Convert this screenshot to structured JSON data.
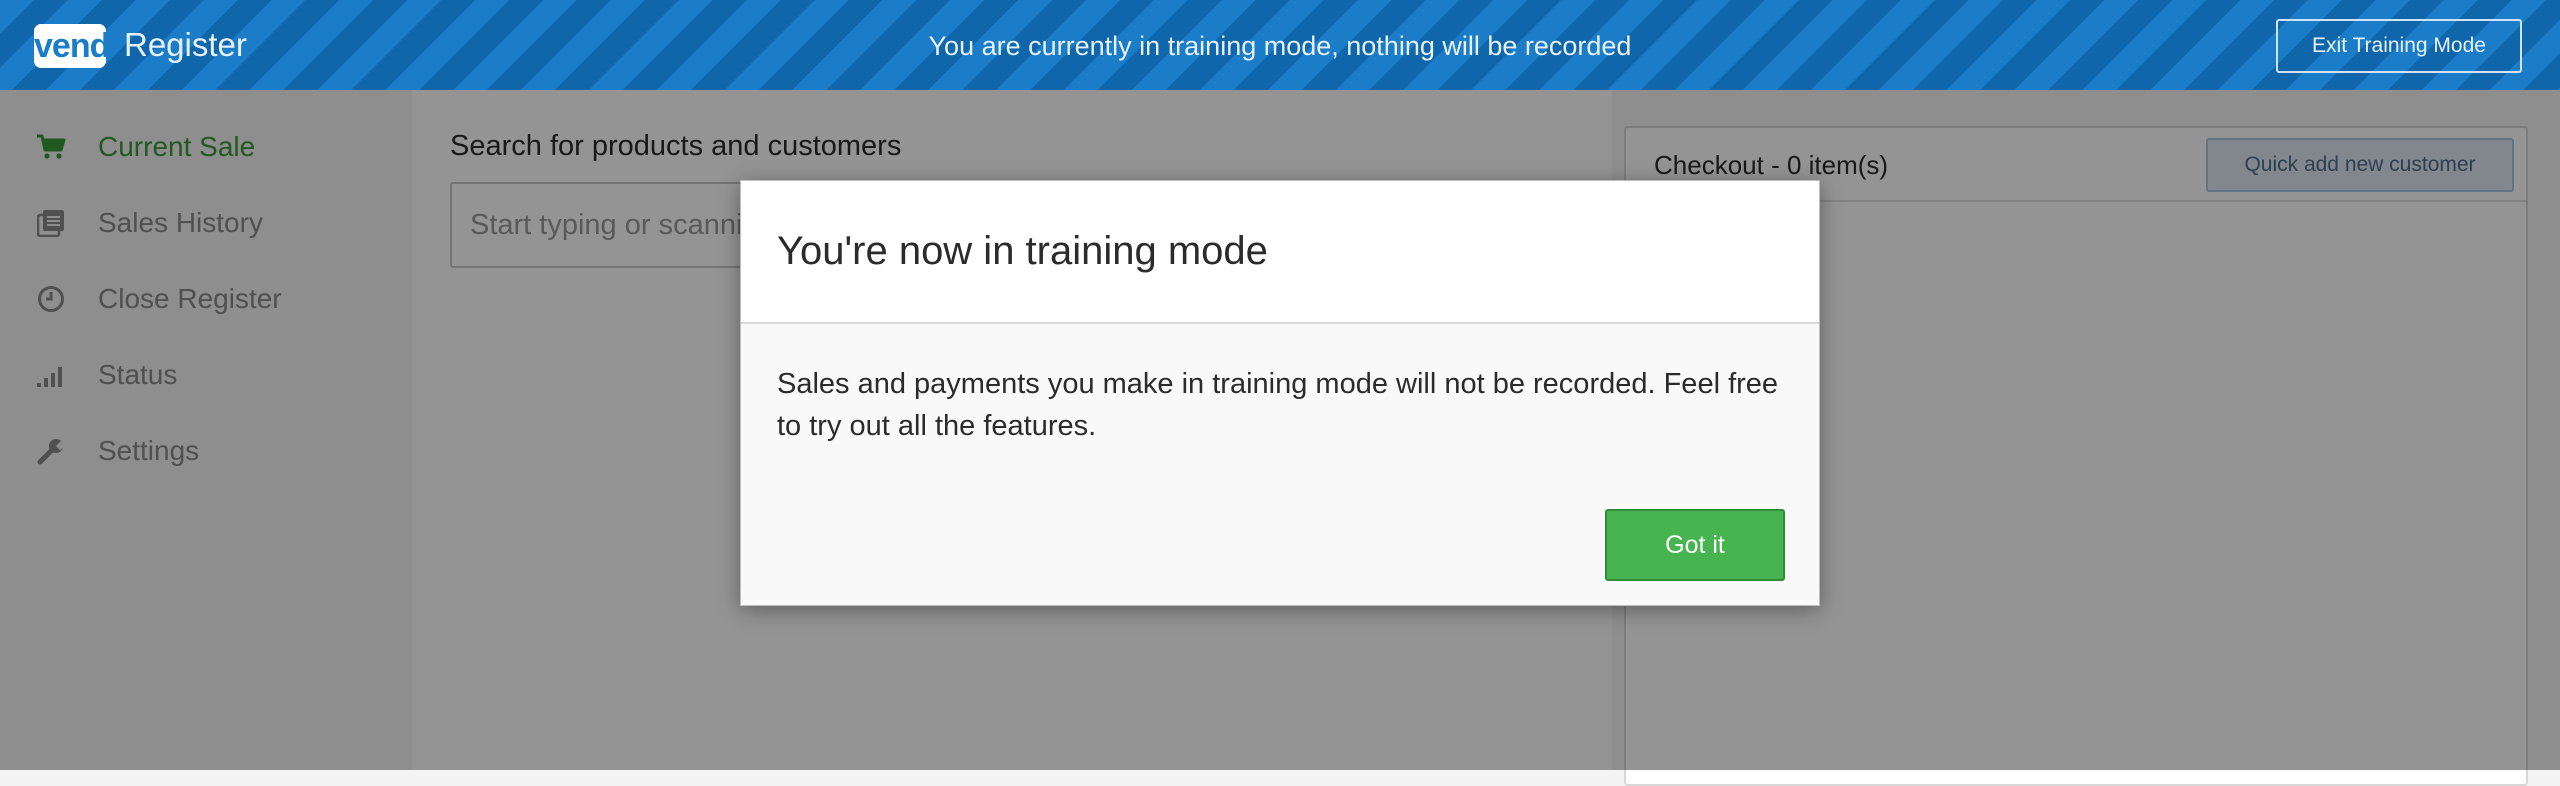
{
  "topbar": {
    "logo_text": "vend",
    "app_title": "Register",
    "banner": "You are currently in training mode, nothing will be recorded",
    "exit_button": "Exit Training Mode",
    "colors": {
      "stripe_light": "#1b7cc7",
      "stripe_dark": "#0f66ab"
    }
  },
  "sidebar": {
    "items": [
      {
        "label": "Current Sale",
        "icon": "cart-icon",
        "active": true
      },
      {
        "label": "Sales History",
        "icon": "history-icon",
        "active": false
      },
      {
        "label": "Close Register",
        "icon": "clock-icon",
        "active": false
      },
      {
        "label": "Status",
        "icon": "signal-icon",
        "active": false
      },
      {
        "label": "Settings",
        "icon": "wrench-icon",
        "active": false
      }
    ],
    "active_color": "#3a9a3a"
  },
  "main": {
    "search_heading": "Search for products and customers",
    "search_placeholder": "Start typing or scanning..."
  },
  "checkout": {
    "title": "Checkout - 0 item(s)",
    "quick_add_button": "Quick add new customer"
  },
  "modal": {
    "title": "You're now in training mode",
    "body": "Sales and payments you make in training mode will not be recorded. Feel free to try out all the features.",
    "confirm_button": "Got it",
    "confirm_color": "#46b550"
  }
}
